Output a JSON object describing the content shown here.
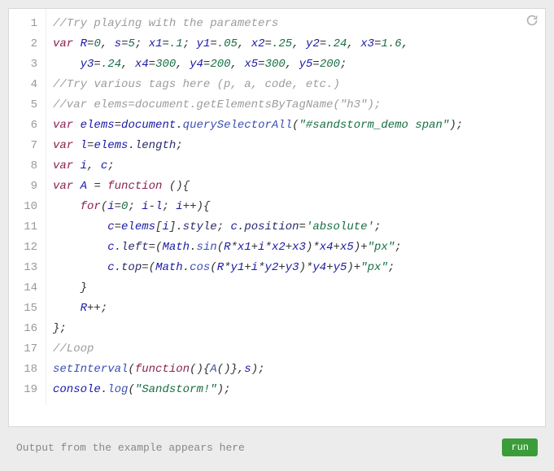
{
  "editor": {
    "line_count": 19,
    "lines_raw": [
      "//Try playing with the parameters",
      "var R=0, s=5; x1=.1; y1=.05, x2=.25, y2=.24, x3=1.6,",
      "    y3=.24, x4=300, y4=200, x5=300, y5=200;",
      "//Try various tags here (p, a, code, etc.)",
      "//var elems=document.getElementsByTagName(\"h3\");",
      "var elems=document.querySelectorAll(\"#sandstorm_demo span\");",
      "var l=elems.length;",
      "var i, c;",
      "var A = function (){",
      "    for(i=0; i-l; i++){",
      "        c=elems[i].style; c.position='absolute';",
      "        c.left=(Math.sin(R*x1+i*x2+x3)*x4+x5)+\"px\";",
      "        c.top=(Math.cos(R*y1+i*y2+y3)*y4+y5)+\"px\";",
      "    }",
      "    R++;",
      "};",
      "//Loop",
      "setInterval(function(){A()},s);",
      "console.log(\"Sandstorm!\");"
    ],
    "lines": [
      [
        {
          "cls": "cm-comment",
          "t": "//Try playing with the parameters"
        }
      ],
      [
        {
          "cls": "cm-keyword",
          "t": "var"
        },
        {
          "cls": "cm-plain",
          "t": " "
        },
        {
          "cls": "cm-variable",
          "t": "R"
        },
        {
          "cls": "cm-op",
          "t": "="
        },
        {
          "cls": "cm-number",
          "t": "0"
        },
        {
          "cls": "cm-plain",
          "t": ", "
        },
        {
          "cls": "cm-variable",
          "t": "s"
        },
        {
          "cls": "cm-op",
          "t": "="
        },
        {
          "cls": "cm-number",
          "t": "5"
        },
        {
          "cls": "cm-plain",
          "t": "; "
        },
        {
          "cls": "cm-variable",
          "t": "x1"
        },
        {
          "cls": "cm-op",
          "t": "="
        },
        {
          "cls": "cm-number",
          "t": ".1"
        },
        {
          "cls": "cm-plain",
          "t": "; "
        },
        {
          "cls": "cm-variable",
          "t": "y1"
        },
        {
          "cls": "cm-op",
          "t": "="
        },
        {
          "cls": "cm-number",
          "t": ".05"
        },
        {
          "cls": "cm-plain",
          "t": ", "
        },
        {
          "cls": "cm-variable",
          "t": "x2"
        },
        {
          "cls": "cm-op",
          "t": "="
        },
        {
          "cls": "cm-number",
          "t": ".25"
        },
        {
          "cls": "cm-plain",
          "t": ", "
        },
        {
          "cls": "cm-variable",
          "t": "y2"
        },
        {
          "cls": "cm-op",
          "t": "="
        },
        {
          "cls": "cm-number",
          "t": ".24"
        },
        {
          "cls": "cm-plain",
          "t": ", "
        },
        {
          "cls": "cm-variable",
          "t": "x3"
        },
        {
          "cls": "cm-op",
          "t": "="
        },
        {
          "cls": "cm-number",
          "t": "1.6"
        },
        {
          "cls": "cm-plain",
          "t": ","
        }
      ],
      [
        {
          "cls": "cm-plain",
          "t": "    "
        },
        {
          "cls": "cm-variable",
          "t": "y3"
        },
        {
          "cls": "cm-op",
          "t": "="
        },
        {
          "cls": "cm-number",
          "t": ".24"
        },
        {
          "cls": "cm-plain",
          "t": ", "
        },
        {
          "cls": "cm-variable",
          "t": "x4"
        },
        {
          "cls": "cm-op",
          "t": "="
        },
        {
          "cls": "cm-number",
          "t": "300"
        },
        {
          "cls": "cm-plain",
          "t": ", "
        },
        {
          "cls": "cm-variable",
          "t": "y4"
        },
        {
          "cls": "cm-op",
          "t": "="
        },
        {
          "cls": "cm-number",
          "t": "200"
        },
        {
          "cls": "cm-plain",
          "t": ", "
        },
        {
          "cls": "cm-variable",
          "t": "x5"
        },
        {
          "cls": "cm-op",
          "t": "="
        },
        {
          "cls": "cm-number",
          "t": "300"
        },
        {
          "cls": "cm-plain",
          "t": ", "
        },
        {
          "cls": "cm-variable",
          "t": "y5"
        },
        {
          "cls": "cm-op",
          "t": "="
        },
        {
          "cls": "cm-number",
          "t": "200"
        },
        {
          "cls": "cm-plain",
          "t": ";"
        }
      ],
      [
        {
          "cls": "cm-comment",
          "t": "//Try various tags here (p, a, code, etc.)"
        }
      ],
      [
        {
          "cls": "cm-comment",
          "t": "//var elems=document.getElementsByTagName(\"h3\");"
        }
      ],
      [
        {
          "cls": "cm-keyword",
          "t": "var"
        },
        {
          "cls": "cm-plain",
          "t": " "
        },
        {
          "cls": "cm-variable",
          "t": "elems"
        },
        {
          "cls": "cm-op",
          "t": "="
        },
        {
          "cls": "cm-variable",
          "t": "document"
        },
        {
          "cls": "cm-plain",
          "t": "."
        },
        {
          "cls": "cm-func",
          "t": "querySelectorAll"
        },
        {
          "cls": "cm-plain",
          "t": "("
        },
        {
          "cls": "cm-string",
          "t": "\"#sandstorm_demo span\""
        },
        {
          "cls": "cm-plain",
          "t": ");"
        }
      ],
      [
        {
          "cls": "cm-keyword",
          "t": "var"
        },
        {
          "cls": "cm-plain",
          "t": " "
        },
        {
          "cls": "cm-variable",
          "t": "l"
        },
        {
          "cls": "cm-op",
          "t": "="
        },
        {
          "cls": "cm-variable",
          "t": "elems"
        },
        {
          "cls": "cm-plain",
          "t": "."
        },
        {
          "cls": "cm-prop",
          "t": "length"
        },
        {
          "cls": "cm-plain",
          "t": ";"
        }
      ],
      [
        {
          "cls": "cm-keyword",
          "t": "var"
        },
        {
          "cls": "cm-plain",
          "t": " "
        },
        {
          "cls": "cm-variable",
          "t": "i"
        },
        {
          "cls": "cm-plain",
          "t": ", "
        },
        {
          "cls": "cm-variable",
          "t": "c"
        },
        {
          "cls": "cm-plain",
          "t": ";"
        }
      ],
      [
        {
          "cls": "cm-keyword",
          "t": "var"
        },
        {
          "cls": "cm-plain",
          "t": " "
        },
        {
          "cls": "cm-variable",
          "t": "A"
        },
        {
          "cls": "cm-plain",
          "t": " "
        },
        {
          "cls": "cm-op",
          "t": "="
        },
        {
          "cls": "cm-plain",
          "t": " "
        },
        {
          "cls": "cm-keyword",
          "t": "function"
        },
        {
          "cls": "cm-plain",
          "t": " (){"
        }
      ],
      [
        {
          "cls": "cm-plain",
          "t": "    "
        },
        {
          "cls": "cm-keyword",
          "t": "for"
        },
        {
          "cls": "cm-plain",
          "t": "("
        },
        {
          "cls": "cm-variable",
          "t": "i"
        },
        {
          "cls": "cm-op",
          "t": "="
        },
        {
          "cls": "cm-number",
          "t": "0"
        },
        {
          "cls": "cm-plain",
          "t": "; "
        },
        {
          "cls": "cm-variable",
          "t": "i"
        },
        {
          "cls": "cm-op",
          "t": "-"
        },
        {
          "cls": "cm-variable",
          "t": "l"
        },
        {
          "cls": "cm-plain",
          "t": "; "
        },
        {
          "cls": "cm-variable",
          "t": "i"
        },
        {
          "cls": "cm-op",
          "t": "++"
        },
        {
          "cls": "cm-plain",
          "t": "){"
        }
      ],
      [
        {
          "cls": "cm-plain",
          "t": "        "
        },
        {
          "cls": "cm-variable",
          "t": "c"
        },
        {
          "cls": "cm-op",
          "t": "="
        },
        {
          "cls": "cm-variable",
          "t": "elems"
        },
        {
          "cls": "cm-plain",
          "t": "["
        },
        {
          "cls": "cm-variable",
          "t": "i"
        },
        {
          "cls": "cm-plain",
          "t": "]."
        },
        {
          "cls": "cm-prop",
          "t": "style"
        },
        {
          "cls": "cm-plain",
          "t": "; "
        },
        {
          "cls": "cm-variable",
          "t": "c"
        },
        {
          "cls": "cm-plain",
          "t": "."
        },
        {
          "cls": "cm-prop",
          "t": "position"
        },
        {
          "cls": "cm-op",
          "t": "="
        },
        {
          "cls": "cm-string",
          "t": "'absolute'"
        },
        {
          "cls": "cm-plain",
          "t": ";"
        }
      ],
      [
        {
          "cls": "cm-plain",
          "t": "        "
        },
        {
          "cls": "cm-variable",
          "t": "c"
        },
        {
          "cls": "cm-plain",
          "t": "."
        },
        {
          "cls": "cm-prop",
          "t": "left"
        },
        {
          "cls": "cm-op",
          "t": "="
        },
        {
          "cls": "cm-plain",
          "t": "("
        },
        {
          "cls": "cm-variable",
          "t": "Math"
        },
        {
          "cls": "cm-plain",
          "t": "."
        },
        {
          "cls": "cm-func",
          "t": "sin"
        },
        {
          "cls": "cm-plain",
          "t": "("
        },
        {
          "cls": "cm-variable",
          "t": "R"
        },
        {
          "cls": "cm-op",
          "t": "*"
        },
        {
          "cls": "cm-variable",
          "t": "x1"
        },
        {
          "cls": "cm-op",
          "t": "+"
        },
        {
          "cls": "cm-variable",
          "t": "i"
        },
        {
          "cls": "cm-op",
          "t": "*"
        },
        {
          "cls": "cm-variable",
          "t": "x2"
        },
        {
          "cls": "cm-op",
          "t": "+"
        },
        {
          "cls": "cm-variable",
          "t": "x3"
        },
        {
          "cls": "cm-plain",
          "t": ")"
        },
        {
          "cls": "cm-op",
          "t": "*"
        },
        {
          "cls": "cm-variable",
          "t": "x4"
        },
        {
          "cls": "cm-op",
          "t": "+"
        },
        {
          "cls": "cm-variable",
          "t": "x5"
        },
        {
          "cls": "cm-plain",
          "t": ")"
        },
        {
          "cls": "cm-op",
          "t": "+"
        },
        {
          "cls": "cm-string",
          "t": "\"px\""
        },
        {
          "cls": "cm-plain",
          "t": ";"
        }
      ],
      [
        {
          "cls": "cm-plain",
          "t": "        "
        },
        {
          "cls": "cm-variable",
          "t": "c"
        },
        {
          "cls": "cm-plain",
          "t": "."
        },
        {
          "cls": "cm-prop",
          "t": "top"
        },
        {
          "cls": "cm-op",
          "t": "="
        },
        {
          "cls": "cm-plain",
          "t": "("
        },
        {
          "cls": "cm-variable",
          "t": "Math"
        },
        {
          "cls": "cm-plain",
          "t": "."
        },
        {
          "cls": "cm-func",
          "t": "cos"
        },
        {
          "cls": "cm-plain",
          "t": "("
        },
        {
          "cls": "cm-variable",
          "t": "R"
        },
        {
          "cls": "cm-op",
          "t": "*"
        },
        {
          "cls": "cm-variable",
          "t": "y1"
        },
        {
          "cls": "cm-op",
          "t": "+"
        },
        {
          "cls": "cm-variable",
          "t": "i"
        },
        {
          "cls": "cm-op",
          "t": "*"
        },
        {
          "cls": "cm-variable",
          "t": "y2"
        },
        {
          "cls": "cm-op",
          "t": "+"
        },
        {
          "cls": "cm-variable",
          "t": "y3"
        },
        {
          "cls": "cm-plain",
          "t": ")"
        },
        {
          "cls": "cm-op",
          "t": "*"
        },
        {
          "cls": "cm-variable",
          "t": "y4"
        },
        {
          "cls": "cm-op",
          "t": "+"
        },
        {
          "cls": "cm-variable",
          "t": "y5"
        },
        {
          "cls": "cm-plain",
          "t": ")"
        },
        {
          "cls": "cm-op",
          "t": "+"
        },
        {
          "cls": "cm-string",
          "t": "\"px\""
        },
        {
          "cls": "cm-plain",
          "t": ";"
        }
      ],
      [
        {
          "cls": "cm-plain",
          "t": "    }"
        }
      ],
      [
        {
          "cls": "cm-plain",
          "t": "    "
        },
        {
          "cls": "cm-variable",
          "t": "R"
        },
        {
          "cls": "cm-op",
          "t": "++"
        },
        {
          "cls": "cm-plain",
          "t": ";"
        }
      ],
      [
        {
          "cls": "cm-plain",
          "t": "};"
        }
      ],
      [
        {
          "cls": "cm-comment",
          "t": "//Loop"
        }
      ],
      [
        {
          "cls": "cm-func",
          "t": "setInterval"
        },
        {
          "cls": "cm-plain",
          "t": "("
        },
        {
          "cls": "cm-keyword",
          "t": "function"
        },
        {
          "cls": "cm-plain",
          "t": "(){"
        },
        {
          "cls": "cm-func",
          "t": "A"
        },
        {
          "cls": "cm-plain",
          "t": "()},"
        },
        {
          "cls": "cm-variable",
          "t": "s"
        },
        {
          "cls": "cm-plain",
          "t": ");"
        }
      ],
      [
        {
          "cls": "cm-variable",
          "t": "console"
        },
        {
          "cls": "cm-plain",
          "t": "."
        },
        {
          "cls": "cm-func",
          "t": "log"
        },
        {
          "cls": "cm-plain",
          "t": "("
        },
        {
          "cls": "cm-string",
          "t": "\"Sandstorm!\""
        },
        {
          "cls": "cm-plain",
          "t": ");"
        }
      ]
    ]
  },
  "output": {
    "placeholder": "Output from the example appears here",
    "run_label": "run"
  },
  "icons": {
    "refresh": "refresh-icon"
  },
  "colors": {
    "bg": "#ececec",
    "editor_bg": "#ffffff",
    "run_btn": "#3a9d3a",
    "comment": "#9c9c9c",
    "keyword": "#8b2252",
    "variable": "#1a1aa6",
    "number": "#176f42",
    "string": "#176f42"
  }
}
